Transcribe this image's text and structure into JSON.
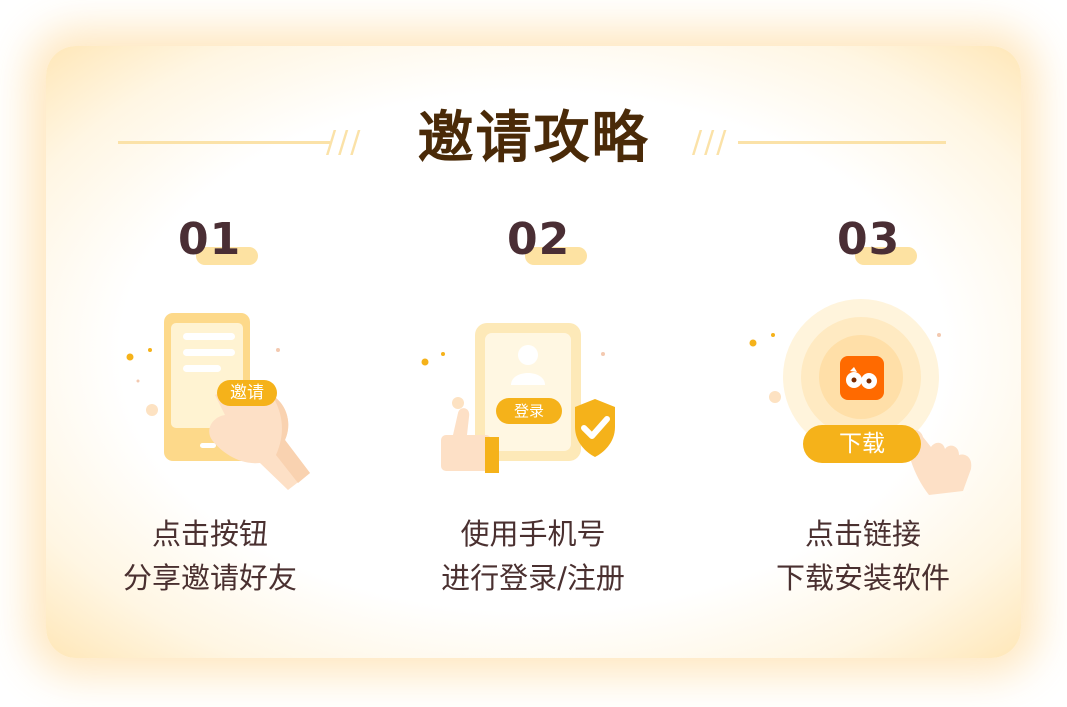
{
  "title": "邀请攻略",
  "title_decoration": "///",
  "steps": [
    {
      "number": "01",
      "lines": [
        "点击按钮",
        "分享邀请好友"
      ],
      "button_label": "邀请"
    },
    {
      "number": "02",
      "lines": [
        "使用手机号",
        "进行登录/注册"
      ],
      "button_label": "登录"
    },
    {
      "number": "03",
      "lines": [
        "点击链接",
        "下载安装软件"
      ],
      "button_label": "下载"
    }
  ],
  "colors": {
    "accent": "#f5b21a",
    "pale_accent": "#fde2a2",
    "title_text": "#4a2a08",
    "number_text": "#4a2e34",
    "app_icon": "#ff6a00"
  }
}
